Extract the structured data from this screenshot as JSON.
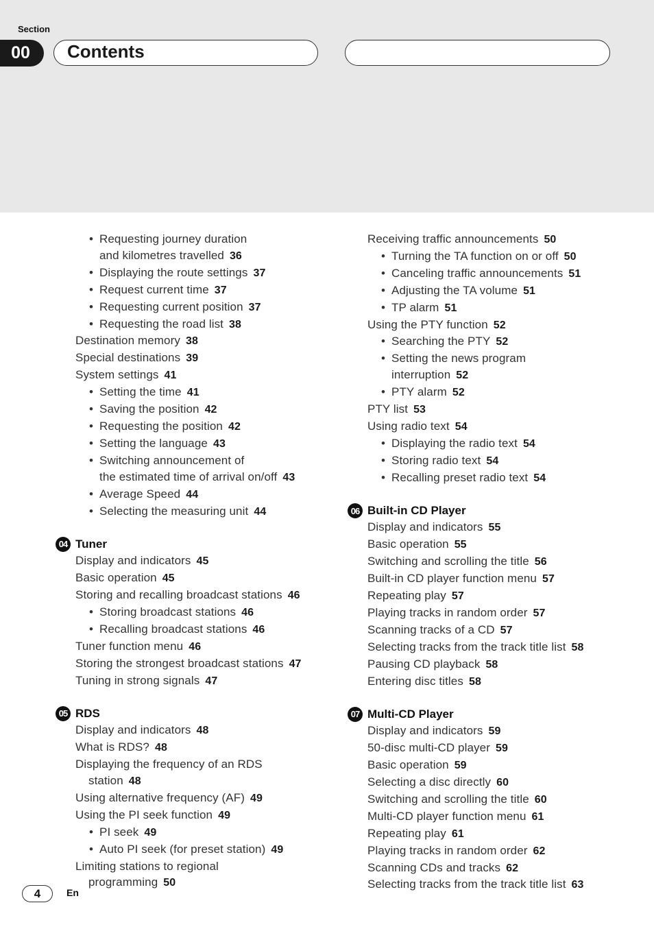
{
  "header": {
    "section_label": "Section",
    "section_number": "00",
    "title": "Contents"
  },
  "left_column": {
    "block1": [
      {
        "text": "Requesting journey duration",
        "page": "",
        "level": 1
      },
      {
        "text": "and kilometres travelled",
        "page": "36",
        "level": "cont1"
      },
      {
        "text": "Displaying the route settings",
        "page": "37",
        "level": 1
      },
      {
        "text": "Request current time",
        "page": "37",
        "level": 1
      },
      {
        "text": "Requesting current position",
        "page": "37",
        "level": 1
      },
      {
        "text": "Requesting the road list",
        "page": "38",
        "level": 1
      },
      {
        "text": "Destination memory",
        "page": "38",
        "level": 0
      },
      {
        "text": "Special destinations",
        "page": "39",
        "level": 0
      },
      {
        "text": "System settings",
        "page": "41",
        "level": 0
      },
      {
        "text": "Setting the time",
        "page": "41",
        "level": 1
      },
      {
        "text": "Saving the position",
        "page": "42",
        "level": 1
      },
      {
        "text": "Requesting the position",
        "page": "42",
        "level": 1
      },
      {
        "text": "Setting the language",
        "page": "43",
        "level": 1
      },
      {
        "text": "Switching announcement of",
        "page": "",
        "level": 1
      },
      {
        "text": "the estimated time of arrival on/off",
        "page": "43",
        "level": "cont1"
      },
      {
        "text": "Average Speed",
        "page": "44",
        "level": 1
      },
      {
        "text": "Selecting the measuring unit",
        "page": "44",
        "level": 1
      }
    ],
    "chapter04": {
      "number": "04",
      "title": "Tuner",
      "entries": [
        {
          "text": "Display and indicators",
          "page": "45",
          "level": 0
        },
        {
          "text": "Basic operation",
          "page": "45",
          "level": 0
        },
        {
          "text": "Storing and recalling broadcast stations",
          "page": "46",
          "level": 0
        },
        {
          "text": "Storing broadcast stations",
          "page": "46",
          "level": 1
        },
        {
          "text": "Recalling broadcast stations",
          "page": "46",
          "level": 1
        },
        {
          "text": "Tuner function menu",
          "page": "46",
          "level": 0
        },
        {
          "text": "Storing the strongest broadcast stations",
          "page": "47",
          "level": 0
        },
        {
          "text": "Tuning in strong signals",
          "page": "47",
          "level": 0
        }
      ]
    },
    "chapter05": {
      "number": "05",
      "title": "RDS",
      "entries": [
        {
          "text": "Display and indicators",
          "page": "48",
          "level": 0
        },
        {
          "text": "What is RDS?",
          "page": "48",
          "level": 0
        },
        {
          "text": "Displaying the frequency of an RDS",
          "page": "",
          "level": 0
        },
        {
          "text": "station",
          "page": "48",
          "level": "cont0"
        },
        {
          "text": "Using alternative frequency (AF)",
          "page": "49",
          "level": 0
        },
        {
          "text": "Using the PI seek function",
          "page": "49",
          "level": 0
        },
        {
          "text": "PI seek",
          "page": "49",
          "level": 1
        },
        {
          "text": "Auto PI seek (for preset station)",
          "page": "49",
          "level": 1
        },
        {
          "text": "Limiting stations to regional",
          "page": "",
          "level": 0
        },
        {
          "text": "programming",
          "page": "50",
          "level": "cont0"
        }
      ]
    }
  },
  "right_column": {
    "block1": [
      {
        "text": "Receiving traffic announcements",
        "page": "50",
        "level": 0
      },
      {
        "text": "Turning the TA function on or off",
        "page": "50",
        "level": 1
      },
      {
        "text": "Canceling traffic announcements",
        "page": "51",
        "level": 1
      },
      {
        "text": "Adjusting the TA volume",
        "page": "51",
        "level": 1
      },
      {
        "text": "TP alarm",
        "page": "51",
        "level": 1
      },
      {
        "text": "Using the PTY function",
        "page": "52",
        "level": 0
      },
      {
        "text": "Searching the PTY",
        "page": "52",
        "level": 1
      },
      {
        "text": "Setting the news program",
        "page": "",
        "level": 1
      },
      {
        "text": "interruption",
        "page": "52",
        "level": "cont1"
      },
      {
        "text": "PTY alarm",
        "page": "52",
        "level": 1
      },
      {
        "text": "PTY list",
        "page": "53",
        "level": 0
      },
      {
        "text": "Using radio text",
        "page": "54",
        "level": 0
      },
      {
        "text": "Displaying the radio text",
        "page": "54",
        "level": 1
      },
      {
        "text": "Storing radio text",
        "page": "54",
        "level": 1
      },
      {
        "text": "Recalling preset radio text",
        "page": "54",
        "level": 1
      }
    ],
    "chapter06": {
      "number": "06",
      "title": "Built-in CD Player",
      "entries": [
        {
          "text": "Display and indicators",
          "page": "55",
          "level": 0
        },
        {
          "text": "Basic operation",
          "page": "55",
          "level": 0
        },
        {
          "text": "Switching and scrolling the title",
          "page": "56",
          "level": 0
        },
        {
          "text": "Built-in CD player function menu",
          "page": "57",
          "level": 0
        },
        {
          "text": "Repeating play",
          "page": "57",
          "level": 0
        },
        {
          "text": "Playing tracks in random order",
          "page": "57",
          "level": 0
        },
        {
          "text": "Scanning tracks of a CD",
          "page": "57",
          "level": 0
        },
        {
          "text": "Selecting tracks from the track title list",
          "page": "58",
          "level": 0
        },
        {
          "text": "Pausing CD playback",
          "page": "58",
          "level": 0
        },
        {
          "text": "Entering disc titles",
          "page": "58",
          "level": 0
        }
      ]
    },
    "chapter07": {
      "number": "07",
      "title": "Multi-CD Player",
      "entries": [
        {
          "text": "Display and indicators",
          "page": "59",
          "level": 0
        },
        {
          "text": "50-disc multi-CD player",
          "page": "59",
          "level": 0
        },
        {
          "text": "Basic operation",
          "page": "59",
          "level": 0
        },
        {
          "text": "Selecting a disc directly",
          "page": "60",
          "level": 0
        },
        {
          "text": "Switching and scrolling the title",
          "page": "60",
          "level": 0
        },
        {
          "text": "Multi-CD player function menu",
          "page": "61",
          "level": 0
        },
        {
          "text": "Repeating play",
          "page": "61",
          "level": 0
        },
        {
          "text": "Playing tracks in random order",
          "page": "62",
          "level": 0
        },
        {
          "text": "Scanning CDs and tracks",
          "page": "62",
          "level": 0
        },
        {
          "text": "Selecting tracks from the track title list",
          "page": "63",
          "level": 0
        }
      ]
    }
  },
  "footer": {
    "page_number": "4",
    "language": "En"
  }
}
